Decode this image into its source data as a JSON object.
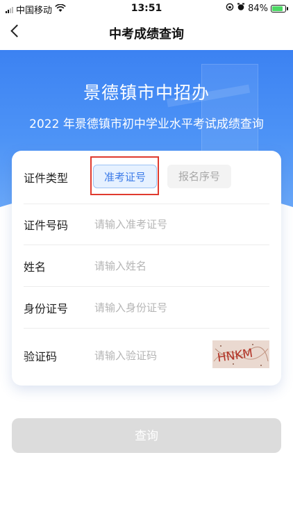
{
  "status_bar": {
    "carrier": "中国移动",
    "time": "13:51",
    "battery": "84%"
  },
  "nav": {
    "title": "中考成绩查询"
  },
  "banner": {
    "title": "景德镇市中招办",
    "subtitle": "2022 年景德镇市初中学业水平考试成绩查询"
  },
  "form": {
    "id_type": {
      "label": "证件类型",
      "options": [
        "准考证号",
        "报名序号"
      ],
      "selected": "准考证号"
    },
    "id_number": {
      "label": "证件号码",
      "placeholder": "请输入准考证号",
      "value": ""
    },
    "name": {
      "label": "姓名",
      "placeholder": "请输入姓名",
      "value": ""
    },
    "id_card": {
      "label": "身份证号",
      "placeholder": "请输入身份证号",
      "value": ""
    },
    "captcha": {
      "label": "验证码",
      "placeholder": "请输入验证码",
      "value": "",
      "image_text": "HNKM"
    }
  },
  "submit_label": "查询",
  "colors": {
    "accent": "#3a7ae8",
    "banner": "#4d93f6",
    "highlight": "#e03a2e",
    "disabled_button": "#dcdcdc"
  }
}
